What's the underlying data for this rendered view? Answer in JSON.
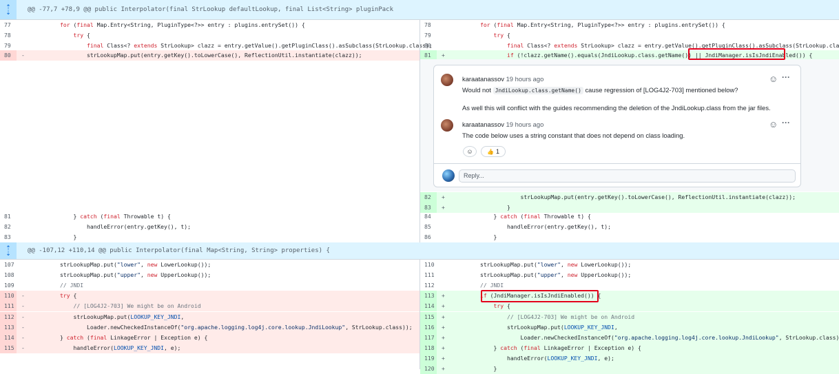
{
  "hunks": [
    {
      "text": "@@ -77,7 +78,9 @@ public Interpolator(final StrLookup defaultLookup, final List<String> pluginPack"
    },
    {
      "text": "@@ -107,12 +110,14 @@ public Interpolator(final Map<String, String> properties) {"
    }
  ],
  "left_block1": [
    {
      "num": "77",
      "sign": "",
      "code": "        for (final Map.Entry<String, PluginType<?>> entry : plugins.entrySet()) {"
    },
    {
      "num": "78",
      "sign": "",
      "code": "            try {"
    },
    {
      "num": "79",
      "sign": "",
      "code": "                final Class<? extends StrLookup> clazz = entry.getValue().getPluginClass().asSubclass(StrLookup.class);"
    },
    {
      "num": "80",
      "sign": "-",
      "code": "                strLookupMap.put(entry.getKey().toLowerCase(), ReflectionUtil.instantiate(clazz));"
    }
  ],
  "right_block1": [
    {
      "num": "78",
      "sign": "",
      "code": "        for (final Map.Entry<String, PluginType<?>> entry : plugins.entrySet()) {"
    },
    {
      "num": "79",
      "sign": "",
      "code": "            try {"
    },
    {
      "num": "80",
      "sign": "",
      "code": "                final Class<? extends StrLookup> clazz = entry.getValue().getPluginClass().asSubclass(StrLookup.class);"
    },
    {
      "num": "81",
      "sign": "+",
      "code": "                if (!clazz.getName().equals(JndiLookup.class.getName()) || JndiManager.isIsJndiEnabled()) {"
    }
  ],
  "thread": {
    "comments": [
      {
        "author": "karaatanassov",
        "time": "19 hours ago",
        "body_pre": "Would not ",
        "body_code": "JndiLookup.class.getName()",
        "body_post": " cause regression of [LOG4J2-703] mentioned below?",
        "body2": "As well this will conflict with the guides recommending the deletion of the JndiLookup.class from the jar files."
      },
      {
        "author": "karaatanassov",
        "time": "19 hours ago",
        "body": "The code below uses a string constant that does not depend on class loading."
      }
    ],
    "reaction_count": "1",
    "reply_placeholder": "Reply...",
    "more_icon": "···",
    "smile_icon": "☺",
    "thumbs_icon": "👍"
  },
  "right_block2": [
    {
      "num": "82",
      "sign": "+",
      "code": "                    strLookupMap.put(entry.getKey().toLowerCase(), ReflectionUtil.instantiate(clazz));"
    },
    {
      "num": "83",
      "sign": "+",
      "code": "                }"
    }
  ],
  "left_block3": [
    {
      "num": "81",
      "sign": "",
      "code": "            } catch (final Throwable t) {"
    },
    {
      "num": "82",
      "sign": "",
      "code": "                handleError(entry.getKey(), t);"
    },
    {
      "num": "83",
      "sign": "",
      "code": "            }"
    }
  ],
  "right_block3": [
    {
      "num": "84",
      "sign": "",
      "code": "            } catch (final Throwable t) {"
    },
    {
      "num": "85",
      "sign": "",
      "code": "                handleError(entry.getKey(), t);"
    },
    {
      "num": "86",
      "sign": "",
      "code": "            }"
    }
  ],
  "left_block4": [
    {
      "num": "107",
      "sign": "",
      "code": "        strLookupMap.put(\"lower\", new LowerLookup());"
    },
    {
      "num": "108",
      "sign": "",
      "code": "        strLookupMap.put(\"upper\", new UpperLookup());"
    },
    {
      "num": "109",
      "sign": "",
      "code": "        // JNDI"
    },
    {
      "num": "110",
      "sign": "-",
      "code": "        try {"
    },
    {
      "num": "111",
      "sign": "-",
      "code": "            // [LOG4J2-703] We might be on Android"
    },
    {
      "num": "112",
      "sign": "-",
      "code": "            strLookupMap.put(LOOKUP_KEY_JNDI,"
    },
    {
      "num": "113",
      "sign": "-",
      "code": "                Loader.newCheckedInstanceOf(\"org.apache.logging.log4j.core.lookup.JndiLookup\", StrLookup.class));"
    },
    {
      "num": "114",
      "sign": "-",
      "code": "        } catch (final LinkageError | Exception e) {"
    },
    {
      "num": "115",
      "sign": "-",
      "code": "            handleError(LOOKUP_KEY_JNDI, e);"
    }
  ],
  "right_block4": [
    {
      "num": "110",
      "sign": "",
      "code": "        strLookupMap.put(\"lower\", new LowerLookup());"
    },
    {
      "num": "111",
      "sign": "",
      "code": "        strLookupMap.put(\"upper\", new UpperLookup());"
    },
    {
      "num": "112",
      "sign": "",
      "code": "        // JNDI"
    },
    {
      "num": "113",
      "sign": "+",
      "code": "        if (JndiManager.isIsJndiEnabled()) {"
    },
    {
      "num": "114",
      "sign": "+",
      "code": "            try {"
    },
    {
      "num": "115",
      "sign": "+",
      "code": "                // [LOG4J2-703] We might be on Android"
    },
    {
      "num": "116",
      "sign": "+",
      "code": "                strLookupMap.put(LOOKUP_KEY_JNDI,"
    },
    {
      "num": "117",
      "sign": "+",
      "code": "                    Loader.newCheckedInstanceOf(\"org.apache.logging.log4j.core.lookup.JndiLookup\", StrLookup.class));"
    },
    {
      "num": "118",
      "sign": "+",
      "code": "            } catch (final LinkageError | Exception e) {"
    },
    {
      "num": "119",
      "sign": "+",
      "code": "                handleError(LOOKUP_KEY_JNDI, e);"
    },
    {
      "num": "120",
      "sign": "+",
      "code": "            }"
    }
  ],
  "colors": {
    "deletion_bg": "#ffebe9",
    "addition_bg": "#e6ffec",
    "hunk_bg": "#ddf4ff",
    "highlight_box": "#e3001b"
  }
}
